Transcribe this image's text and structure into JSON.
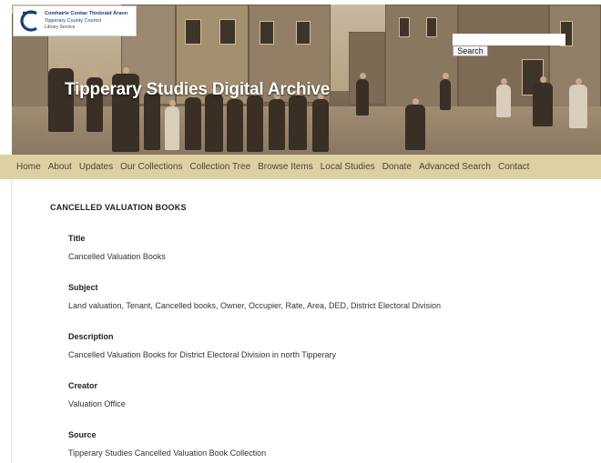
{
  "header": {
    "logo": {
      "line1": "Comhairle Contae Thiobraid Árann",
      "line2": "Tipperary County Council",
      "line3": "Library Service"
    },
    "site_title": "Tipperary Studies Digital Archive",
    "search": {
      "value": "",
      "placeholder": "",
      "button_label": "Search"
    }
  },
  "nav": {
    "items": [
      "Home",
      "About",
      "Updates",
      "Our Collections",
      "Collection Tree",
      "Browse Items",
      "Local Studies",
      "Donate",
      "Advanced Search",
      "Contact"
    ]
  },
  "record": {
    "title": "CANCELLED VALUATION BOOKS",
    "fields": [
      {
        "label": "Title",
        "value": "Cancelled Valuation Books"
      },
      {
        "label": "Subject",
        "value": "Land valuation, Tenant, Cancelled books, Owner, Occupier, Rate, Area, DED, District Electoral Division"
      },
      {
        "label": "Description",
        "value": "Cancelled Valuation Books for District Electoral Division in north Tipperary"
      },
      {
        "label": "Creator",
        "value": "Valuation Office"
      },
      {
        "label": "Source",
        "value": "Tipperary Studies Cancelled Valuation Book Collection"
      }
    ]
  },
  "colors": {
    "nav_background": "#ddd0a3",
    "nav_text": "#4a4636",
    "logo_blue": "#1a3e78",
    "title_text": "#ffffff"
  }
}
